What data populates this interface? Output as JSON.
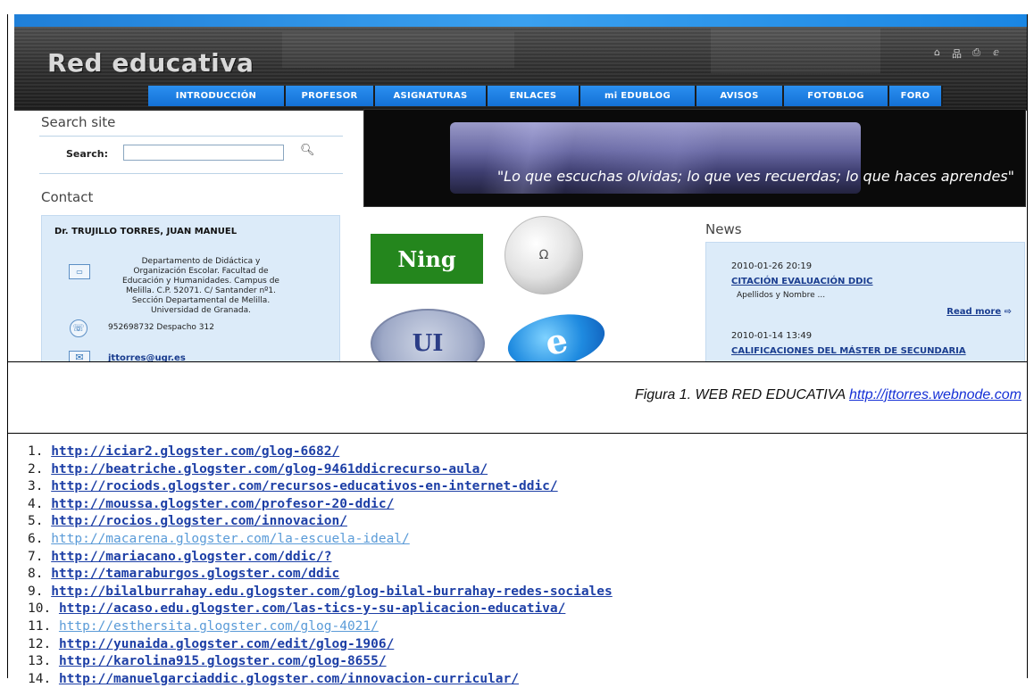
{
  "site": {
    "title": "Red educativa",
    "header_icons": [
      "home-icon",
      "sitemap-icon",
      "print-icon",
      "rss-icon"
    ],
    "header_icon_glyphs": [
      "⌂",
      "品",
      "⎙",
      "ⅇ"
    ],
    "nav": [
      "INTRODUCCIÓN",
      "PROFESOR",
      "ASIGNATURAS",
      "ENLACES",
      "mi EDUBLOG",
      "AVISOS",
      "FOTOBLOG",
      "FORO"
    ],
    "search": {
      "heading": "Search site",
      "label": "Search:",
      "value": ""
    },
    "contact": {
      "heading": "Contact",
      "name": "Dr. TRUJILLO TORRES, JUAN MANUEL",
      "address_lines": [
        "Departamento de Didáctica y",
        "Organización Escolar. Facultad de",
        "Educación y Humanidades. Campus de",
        "Melilla. C.P. 52071. C/ Santander nº1.",
        "Sección Departamental de Melilla.",
        "Universidad de Granada."
      ],
      "phone": "952698732 Despacho 312",
      "email": "jttorres@ugr.es"
    },
    "banner_quote": "\"Lo que escuchas olvidas; lo que ves recuerdas; lo que haces aprendes\"",
    "logos": {
      "ning": "Ning",
      "wiki": "Ω",
      "univ": "UI",
      "ie": "e"
    },
    "news": {
      "heading": "News",
      "items": [
        {
          "date": "2010-01-26 20:19",
          "title": "CITACIÓN EVALUACIÓN DDIC",
          "snippet": "Apellidos y Nombre ..."
        },
        {
          "date": "2010-01-14 13:49",
          "title": "CALIFICACIONES DEL MÁSTER DE SECUNDARIA"
        }
      ],
      "read_more": "Read more",
      "read_more_arrow": "⇨"
    }
  },
  "caption": {
    "text": "Figura 1. WEB RED EDUCATIVA ",
    "url": "http://jttorres.webnode.com"
  },
  "links": [
    {
      "n": "1.",
      "url": "http://iciar2.glogster.com/glog-6682/"
    },
    {
      "n": "2.",
      "url": "http://beatriche.glogster.com/glog-9461ddicrecurso-aula/"
    },
    {
      "n": "3.",
      "url": "http://rociods.glogster.com/recursos-educativos-en-internet-ddic/"
    },
    {
      "n": "4.",
      "url": "http://moussa.glogster.com/profesor-20-ddic/"
    },
    {
      "n": "5.",
      "url": "http://rocios.glogster.com/innovacion/"
    },
    {
      "n": "6.",
      "url": "http://macarena.glogster.com/la-escuela-ideal/",
      "light": true
    },
    {
      "n": "7.",
      "url": "http://mariacano.glogster.com/ddic/?"
    },
    {
      "n": "8.",
      "url": "http://tamaraburgos.glogster.com/ddic"
    },
    {
      "n": "9.",
      "url": "http://bilalburrahay.edu.glogster.com/glog-bilal-burrahay-redes-sociales"
    },
    {
      "n": "10.",
      "url": "http://acaso.edu.glogster.com/las-tics-y-su-aplicacion-educativa/"
    },
    {
      "n": "11.",
      "url": "http://esthersita.glogster.com/glog-4021/",
      "light": true
    },
    {
      "n": "12.",
      "url": "http://yunaida.glogster.com/edit/glog-1906/"
    },
    {
      "n": "13.",
      "url": "http://karolina915.glogster.com/glog-8655/"
    },
    {
      "n": "14.",
      "url": "http://manuelgarciaddic.glogster.com/innovacion-curricular/"
    }
  ]
}
